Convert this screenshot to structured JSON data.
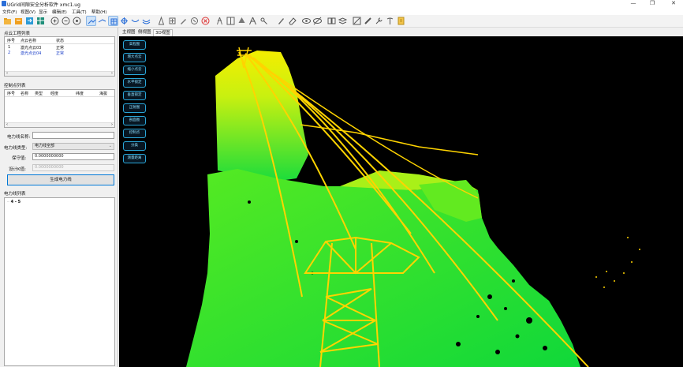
{
  "window": {
    "title": "UGrid间隙安全分析软件 xmc1.ug",
    "minimize": "—",
    "restore": "❐",
    "close": "✕"
  },
  "menu": [
    "文件(F)",
    "视图(V)",
    "显示",
    "编辑(E)",
    "工具(T)",
    "帮助(H)"
  ],
  "toolbar_icons": [
    "new-project-icon",
    "open-folder-icon",
    "import-icon",
    "export-icon",
    "zoom-in-icon",
    "zoom-out-icon",
    "zoom-fit-icon",
    "pan-icon",
    "select-icon",
    "box-select-icon",
    "grid-icon",
    "line-icon",
    "measure-icon",
    "add-point-icon",
    "draw-icon",
    "remove-icon",
    "delete-icon",
    "tower-icon",
    "tower-2-icon",
    "tree-icon",
    "pen-icon",
    "brush-icon",
    "eye-icon",
    "hide-icon",
    "split-icon",
    "layers-icon",
    "edit-icon",
    "pencil-icon",
    "wrench-icon",
    "marker-icon",
    "report-icon"
  ],
  "point_cloud_section": {
    "title": "点云工程列表",
    "columns": [
      "序号",
      "点云名称",
      "状态"
    ],
    "rows": [
      {
        "index": "1",
        "name": "激光点云03",
        "status": "正常"
      },
      {
        "index": "2",
        "name": "激光点云04",
        "status": "正常"
      }
    ]
  },
  "control_point_section": {
    "title": "控制点列表",
    "columns": [
      "序号",
      "名称",
      "类型",
      "经度",
      "纬度",
      "海拔"
    ]
  },
  "line_form": {
    "name_label": "电力线名称:",
    "name_value": "",
    "type_label": "电力线类型:",
    "type_value": "电力线全部",
    "threshold_label": "保守值:",
    "threshold_value": "0.0000000000",
    "design_label": "设计K值:",
    "design_value": "0.0000000000",
    "generate_button": "生成电力线"
  },
  "line_list_section": {
    "title": "电力线列表",
    "items": [
      "4 - 5"
    ]
  },
  "view_tabs": [
    "主视图",
    "侧视图",
    "3D视图"
  ],
  "viewport_buttons": [
    "高程图",
    "增大点云",
    "缩小点云",
    "水平锁定",
    "垂直锁定",
    "正射图",
    "剖面图",
    "控制点",
    "分类",
    "测量距离"
  ],
  "colors": {
    "accent": "#0078d7",
    "viewport_bg": "#000000",
    "cloud_low": "#22e03a",
    "cloud_high": "#f6e800",
    "wire": "#ffd400"
  }
}
